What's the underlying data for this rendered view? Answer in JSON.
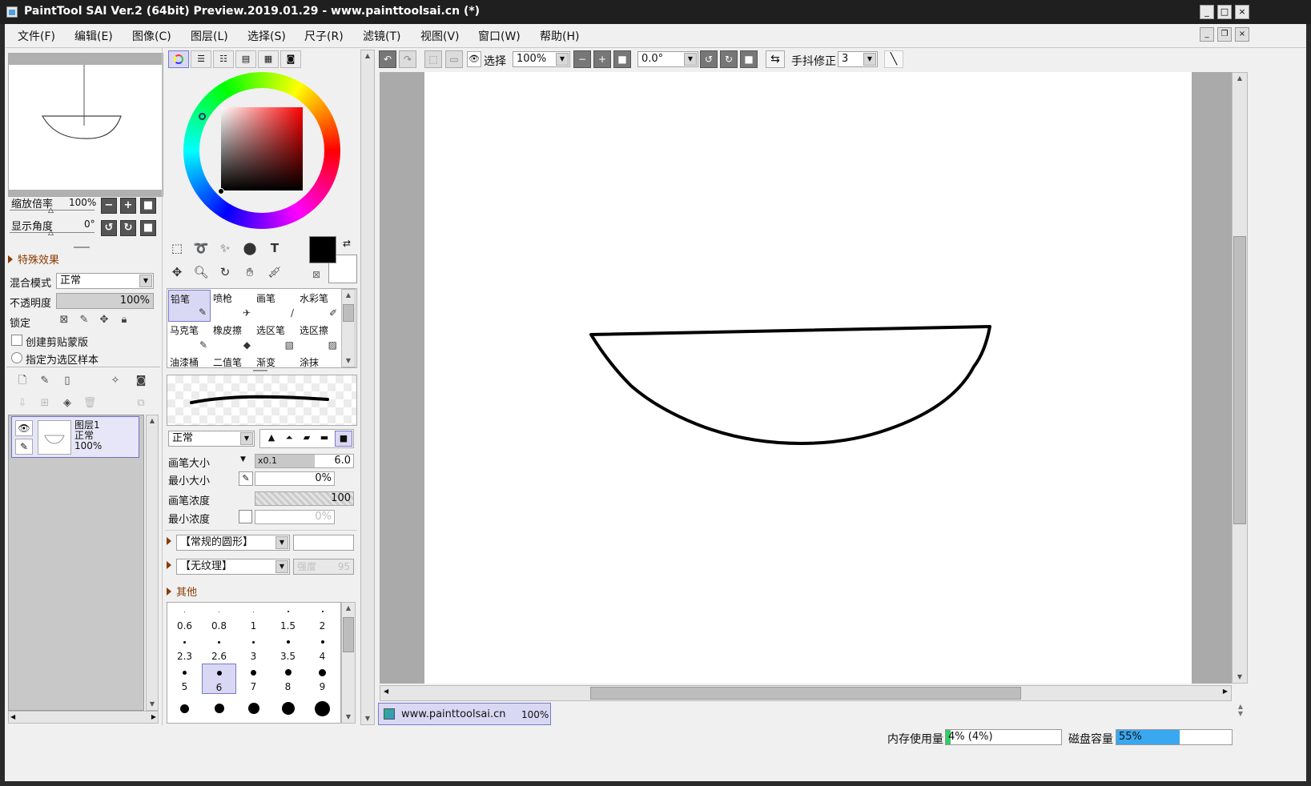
{
  "window": {
    "title": "PaintTool SAI Ver.2 (64bit) Preview.2019.01.29 - www.painttoolsai.cn (*)",
    "controls": [
      "_",
      "□",
      "×"
    ]
  },
  "menu": [
    "文件(F)",
    "编辑(E)",
    "图像(C)",
    "图层(L)",
    "选择(S)",
    "尺子(R)",
    "滤镜(T)",
    "视图(V)",
    "窗口(W)",
    "帮助(H)"
  ],
  "navigator": {
    "zoom_label": "缩放倍率",
    "zoom_value": "100%",
    "angle_label": "显示角度",
    "angle_value": "0°"
  },
  "layer_props": {
    "effects_label": "特殊效果",
    "blend_label": "混合模式",
    "blend_value": "正常",
    "opacity_label": "不透明度",
    "opacity_value": "100%",
    "lock_label": "锁定",
    "clip_label": "创建剪贴蒙版",
    "sel_sample_label": "指定为选区样本"
  },
  "layers": [
    {
      "name": "图层1",
      "mode": "正常",
      "opacity": "100%"
    }
  ],
  "brushes": [
    {
      "label": "铅笔",
      "icon": "✎",
      "selected": true
    },
    {
      "label": "喷枪",
      "icon": "✈"
    },
    {
      "label": "画笔",
      "icon": "/"
    },
    {
      "label": "水彩笔",
      "icon": "✐"
    },
    {
      "label": "马克笔",
      "icon": "✎"
    },
    {
      "label": "橡皮擦",
      "icon": "◆"
    },
    {
      "label": "选区笔",
      "icon": "▧"
    },
    {
      "label": "选区擦",
      "icon": "▨"
    },
    {
      "label": "油漆桶",
      "icon": ""
    },
    {
      "label": "二值笔",
      "icon": ""
    },
    {
      "label": "渐变",
      "icon": ""
    },
    {
      "label": "涂抹",
      "icon": ""
    }
  ],
  "brush_settings": {
    "mode_value": "正常",
    "size_label": "画笔大小",
    "size_multiplier": "x0.1",
    "size_value": "6.0",
    "min_size_label": "最小大小",
    "min_size_value": "0%",
    "density_label": "画笔浓度",
    "density_value": "100",
    "min_density_label": "最小浓度",
    "min_density_value": "0%",
    "shape_value": "【常规的圆形】",
    "texture_value": "【无纹理】",
    "texture_strength_label": "强度",
    "texture_strength_value": "95",
    "other_label": "其他"
  },
  "brush_sizes": [
    {
      "label": "0.6",
      "dot": 1
    },
    {
      "label": "0.8",
      "dot": 1
    },
    {
      "label": "1",
      "dot": 1
    },
    {
      "label": "1.5",
      "dot": 2
    },
    {
      "label": "2",
      "dot": 2
    },
    {
      "label": "2.3",
      "dot": 3
    },
    {
      "label": "2.6",
      "dot": 3
    },
    {
      "label": "3",
      "dot": 3
    },
    {
      "label": "3.5",
      "dot": 4
    },
    {
      "label": "4",
      "dot": 4
    },
    {
      "label": "5",
      "dot": 5
    },
    {
      "label": "6",
      "dot": 6,
      "selected": true
    },
    {
      "label": "7",
      "dot": 7
    },
    {
      "label": "8",
      "dot": 8
    },
    {
      "label": "9",
      "dot": 9
    },
    {
      "label": "",
      "dot": 11
    },
    {
      "label": "",
      "dot": 12
    },
    {
      "label": "",
      "dot": 14
    },
    {
      "label": "",
      "dot": 16
    },
    {
      "label": "",
      "dot": 19
    }
  ],
  "canvas_toolbar": {
    "selection_label": "选择",
    "zoom_value": "100%",
    "angle_value": "0.0°",
    "stabilizer_label": "手抖修正",
    "stabilizer_value": "3"
  },
  "document_tab": {
    "name": "www.painttoolsai.cn",
    "zoom": "100%"
  },
  "status": {
    "memory_label": "内存使用量",
    "memory_value": "4% (4%)",
    "memory_fraction": 0.04,
    "disk_label": "磁盘容量",
    "disk_value": "55%",
    "disk_fraction": 0.55
  },
  "colors": {
    "primary": "#000000",
    "secondary": "#ffffff",
    "selection_highlight": "#d8d8f4",
    "memory_fill": "#33cc66",
    "disk_fill": "#39a8f0"
  }
}
